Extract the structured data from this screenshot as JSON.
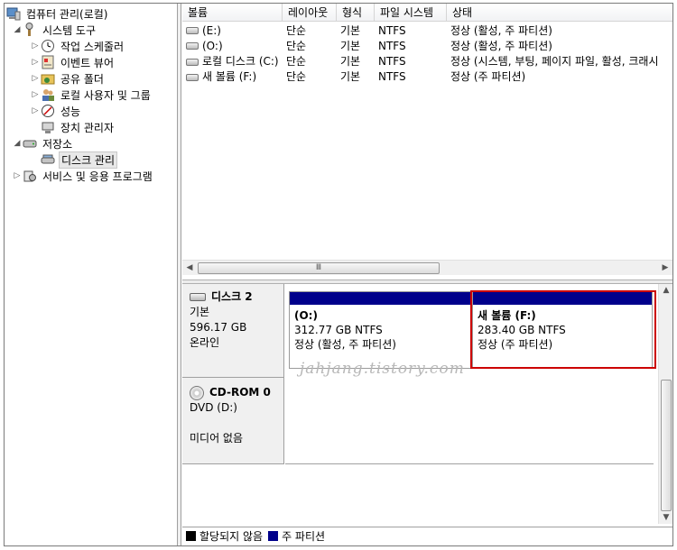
{
  "tree": {
    "items": [
      {
        "label": "컴퓨터 관리(로컬)",
        "icon": "computer-management-icon",
        "arrow": ""
      },
      {
        "label": "시스템 도구",
        "icon": "system-tools-icon",
        "arrow": "◢"
      },
      {
        "label": "작업 스케줄러",
        "icon": "clock-icon",
        "arrow": "▷"
      },
      {
        "label": "이벤트 뷰어",
        "icon": "event-viewer-icon",
        "arrow": "▷"
      },
      {
        "label": "공유 폴더",
        "icon": "shared-folder-icon",
        "arrow": "▷"
      },
      {
        "label": "로컬 사용자 및 그룹",
        "icon": "users-icon",
        "arrow": "▷"
      },
      {
        "label": "성능",
        "icon": "performance-icon",
        "arrow": "▷"
      },
      {
        "label": "장치 관리자",
        "icon": "device-manager-icon",
        "arrow": ""
      },
      {
        "label": "저장소",
        "icon": "storage-icon",
        "arrow": "◢"
      },
      {
        "label": "디스크 관리",
        "icon": "disk-management-icon",
        "arrow": ""
      },
      {
        "label": "서비스 및 응용 프로그램",
        "icon": "services-icon",
        "arrow": "▷"
      }
    ]
  },
  "list": {
    "columns": [
      "볼륨",
      "레이아웃",
      "형식",
      "파일 시스템",
      "상태"
    ],
    "rows": [
      {
        "volume": "(E:)",
        "layout": "단순",
        "type": "기본",
        "fs": "NTFS",
        "status": "정상 (활성, 주 파티션)"
      },
      {
        "volume": "(O:)",
        "layout": "단순",
        "type": "기본",
        "fs": "NTFS",
        "status": "정상 (활성, 주 파티션)"
      },
      {
        "volume": "로컬 디스크 (C:)",
        "layout": "단순",
        "type": "기본",
        "fs": "NTFS",
        "status": "정상 (시스템, 부팅, 페이지 파일, 활성, 크래시"
      },
      {
        "volume": "새 볼륨 (F:)",
        "layout": "단순",
        "type": "기본",
        "fs": "NTFS",
        "status": "정상 (주 파티션)"
      }
    ],
    "scroll_thumb_glyph": "Ⅲ"
  },
  "disk2": {
    "title": "디스크 2",
    "type": "기본",
    "size": "596.17 GB",
    "state": "온라인",
    "partitions": [
      {
        "name": "(O:)",
        "size": "312.77 GB NTFS",
        "status": "정상 (활성, 주 파티션)"
      },
      {
        "name": "새 볼륨  (F:)",
        "size": "283.40 GB NTFS",
        "status": "정상 (주 파티션)"
      }
    ]
  },
  "cdrom": {
    "title": "CD-ROM 0",
    "drive": "DVD (D:)",
    "media": "미디어 없음"
  },
  "watermark": "jahjang.tistory.com",
  "legend": [
    {
      "label": "할당되지 않음",
      "color": "#000000"
    },
    {
      "label": "주 파티션",
      "color": "#00008b"
    }
  ],
  "colors": {
    "primary_partition": "#00008b",
    "highlight": "#cc0000"
  }
}
